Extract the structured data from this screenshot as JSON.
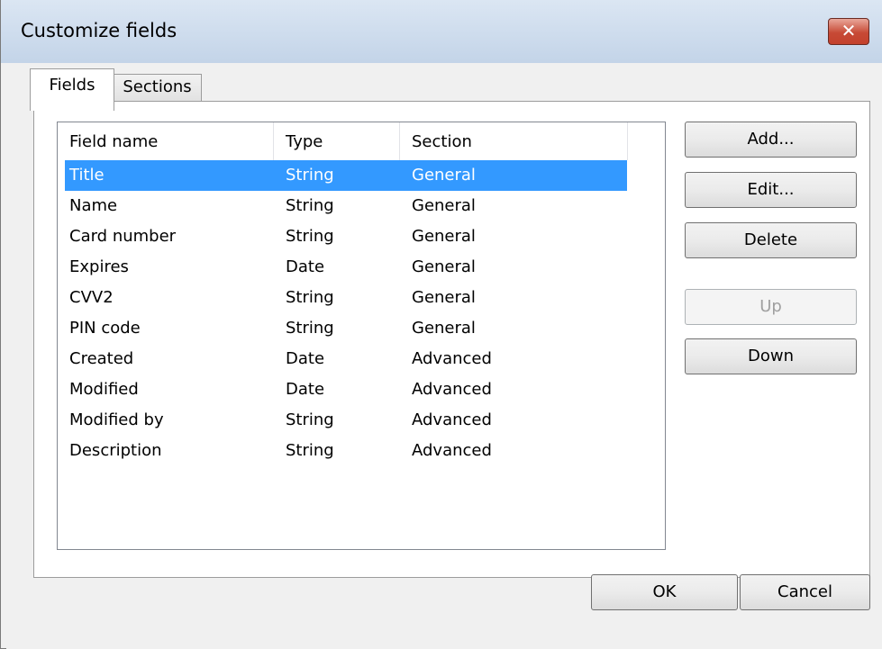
{
  "window": {
    "title": "Customize fields",
    "close_symbol": "✕"
  },
  "tabs": [
    {
      "label": "Fields",
      "active": true
    },
    {
      "label": "Sections",
      "active": false
    }
  ],
  "list": {
    "columns": [
      "Field name",
      "Type",
      "Section"
    ],
    "rows": [
      {
        "name": "Title",
        "type": "String",
        "section": "General",
        "selected": true
      },
      {
        "name": "Name",
        "type": "String",
        "section": "General"
      },
      {
        "name": "Card number",
        "type": "String",
        "section": "General"
      },
      {
        "name": "Expires",
        "type": "Date",
        "section": "General"
      },
      {
        "name": "CVV2",
        "type": "String",
        "section": "General"
      },
      {
        "name": "PIN code",
        "type": "String",
        "section": "General"
      },
      {
        "name": "Created",
        "type": "Date",
        "section": "Advanced"
      },
      {
        "name": "Modified",
        "type": "Date",
        "section": "Advanced"
      },
      {
        "name": "Modified by",
        "type": "String",
        "section": "Advanced"
      },
      {
        "name": "Description",
        "type": "String",
        "section": "Advanced"
      }
    ]
  },
  "side_buttons": {
    "add": "Add...",
    "edit": "Edit...",
    "delete": "Delete",
    "up": "Up",
    "down": "Down"
  },
  "footer": {
    "ok": "OK",
    "cancel": "Cancel"
  },
  "colors": {
    "selection": "#3399ff",
    "close_button": "#c74a36",
    "titlebar": "#c3d4e8"
  }
}
